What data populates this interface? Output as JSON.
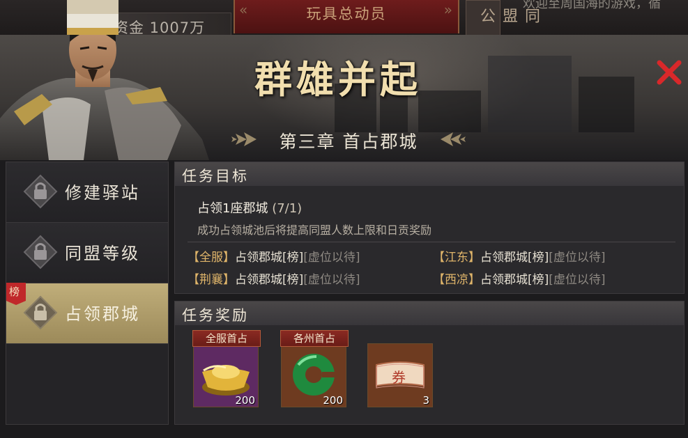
{
  "top_bar": {
    "funds_label": "资金 1007万",
    "event_title": "玩具总动员",
    "alliance_tab": "同盟公",
    "marquee": "欢迎至周国海的游戏，循"
  },
  "panel": {
    "title": "群雄并起",
    "chapter": "第三章 首占郡城",
    "close_icon": "close-x-icon"
  },
  "sidebar": {
    "items": [
      {
        "label": "修建驿站",
        "locked": true,
        "active": false
      },
      {
        "label": "同盟等级",
        "locked": true,
        "active": false
      },
      {
        "label": "占领郡城",
        "locked": true,
        "active": true
      }
    ],
    "rank_badge": "榜"
  },
  "objective": {
    "header": "任务目标",
    "title": "占领1座郡城",
    "progress": "(7/1)",
    "description": "成功占领城池后将提高同盟人数上限和日贡奖励",
    "rankings": [
      {
        "region": "【全服】",
        "city": "占领郡城[榜]",
        "status": "[虚位以待]"
      },
      {
        "region": "【江东】",
        "city": "占领郡城[榜]",
        "status": "[虚位以待]"
      },
      {
        "region": "【荆襄】",
        "city": "占领郡城[榜]",
        "status": "[虚位以待]"
      },
      {
        "region": "【西凉】",
        "city": "占领郡城[榜]",
        "status": "[虚位以待]"
      }
    ]
  },
  "rewards": {
    "header": "任务奖励",
    "items": [
      {
        "tag": "全服首占",
        "icon": "gold-ingot-icon",
        "count": "200",
        "bg": "#6b2e6e"
      },
      {
        "tag": "各州首占",
        "icon": "jade-ring-icon",
        "count": "200",
        "bg": "#7a4326"
      },
      {
        "tag": "",
        "icon": "ticket-coupon-icon",
        "count": "3",
        "bg": "#7a4326",
        "ticket_char": "券"
      }
    ]
  },
  "colors": {
    "accent_gold": "#f1deae",
    "active_tab": "#b09e6b",
    "region_label": "#e0b56a",
    "close_red": "#d8282a"
  }
}
